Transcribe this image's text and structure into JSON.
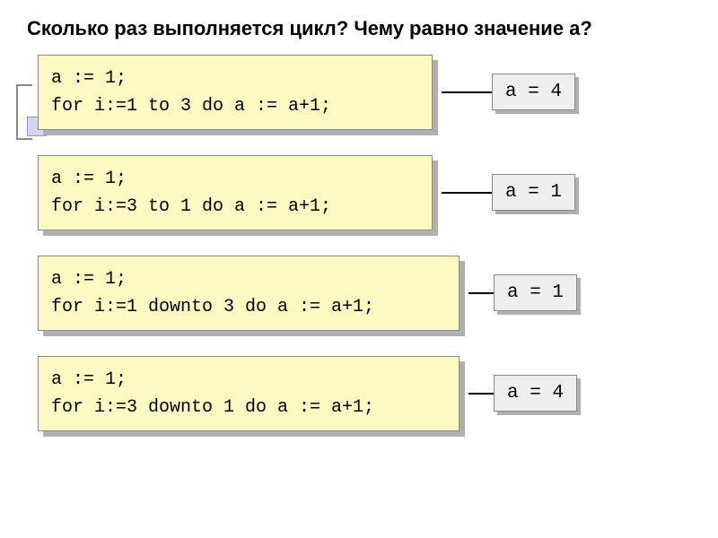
{
  "question": "Сколько раз выполняется цикл? Чему равно значение a?",
  "examples": [
    {
      "code": "a := 1;\nfor i:=1 to 3 do a := a+1;",
      "answer": "a = 4"
    },
    {
      "code": "a := 1;\nfor i:=3 to 1 do a := a+1;",
      "answer": "a = 1"
    },
    {
      "code": "a := 1;\nfor i:=1 downto 3 do a := a+1;",
      "answer": "a = 1"
    },
    {
      "code": "a := 1;\nfor i:=3 downto 1 do a := a+1;",
      "answer": "a = 4"
    }
  ]
}
